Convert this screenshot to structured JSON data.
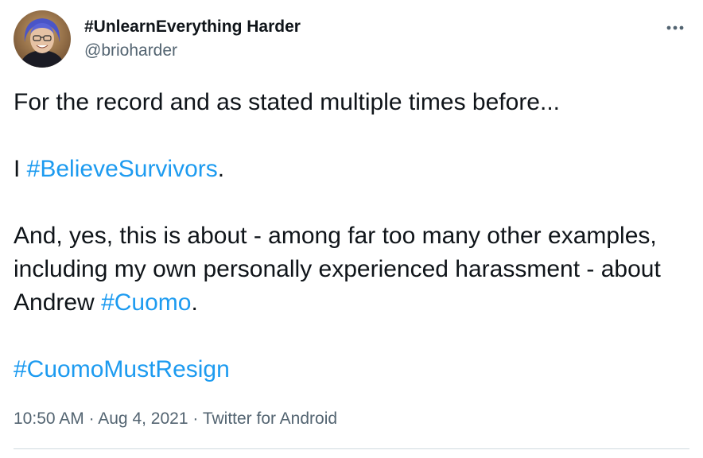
{
  "author": {
    "display_name": "#UnlearnEverything Harder",
    "handle": "@brioharder",
    "avatar_icon": "profile-photo-avatar"
  },
  "more_icon": "more-options-icon",
  "tweet": {
    "line1": "For the record and as stated multiple times before...",
    "para2_prefix": "I ",
    "para2_hashtag": "#BelieveSurvivors",
    "para2_suffix": ".",
    "para3_text": "And, yes, this is about - among far too many other examples, including my own personally experienced harassment - about Andrew ",
    "para3_hashtag": "#Cuomo",
    "para3_suffix": ".",
    "para4_hashtag": "#CuomoMustResign"
  },
  "meta": {
    "time": "10:50 AM",
    "separator": " · ",
    "date": "Aug 4, 2021",
    "source": "Twitter for Android"
  },
  "colors": {
    "link": "#1d9bf0",
    "secondary_text": "#536471",
    "primary_text": "#0f1419",
    "divider": "#cfd9de"
  }
}
